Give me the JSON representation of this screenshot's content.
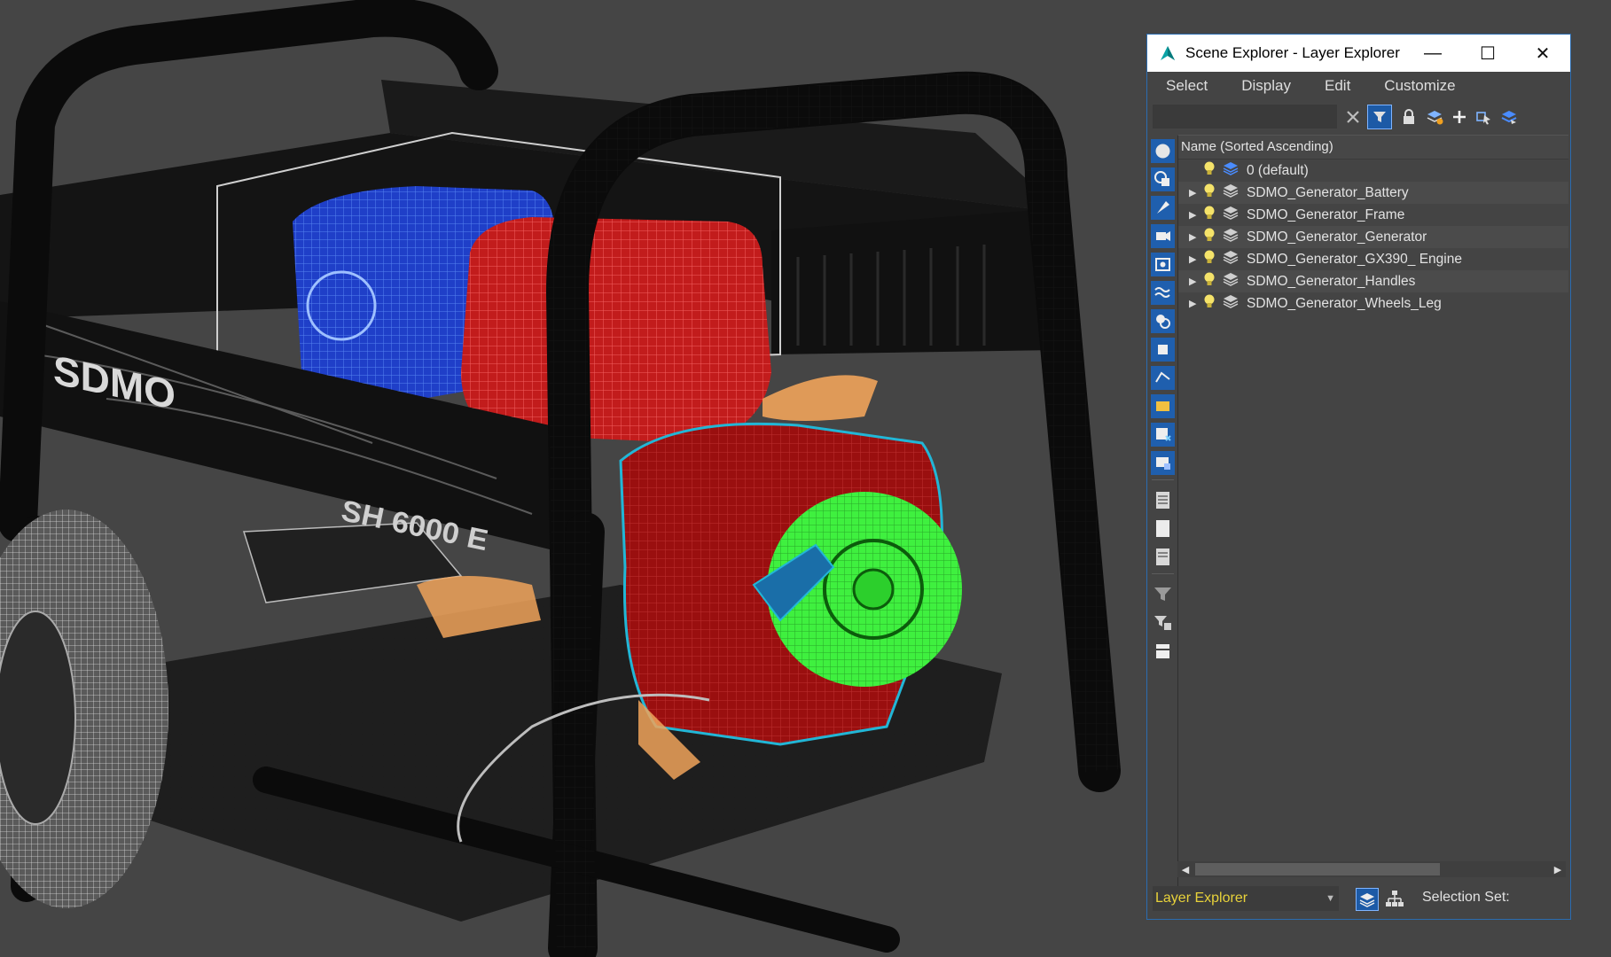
{
  "window": {
    "title": "Scene Explorer - Layer Explorer",
    "minimize": "—",
    "maximize": "☐",
    "close": "✕"
  },
  "menu": [
    "Select",
    "Display",
    "Edit",
    "Customize"
  ],
  "toolbar": {
    "search_value": "",
    "icons": [
      "clear-search-icon",
      "filter-toggle-icon",
      "lock-icon",
      "new-layer-icon",
      "add-to-layer-icon",
      "select-objects-icon",
      "layer-manager-icon"
    ]
  },
  "side_toolbar": {
    "icons": [
      "sphere-icon",
      "shapes-icon",
      "lights-icon",
      "camera-icon",
      "helpers-icon",
      "spacewarp-icon",
      "group-icon",
      "xref-icon",
      "bone-icon",
      "container-icon",
      "frozen-icon",
      "hidden-icon",
      "all-icon",
      "none-icon",
      "invert-icon",
      "filter-icon",
      "filter-settings-icon",
      "tabs-icon"
    ]
  },
  "list": {
    "column_header": "Name (Sorted Ascending)",
    "rows": [
      {
        "name": "0 (default)",
        "expandable": false
      },
      {
        "name": "SDMO_Generator_Battery",
        "expandable": true
      },
      {
        "name": "SDMO_Generator_Frame",
        "expandable": true
      },
      {
        "name": "SDMO_Generator_Generator",
        "expandable": true
      },
      {
        "name": "SDMO_Generator_GX390_ Engine",
        "expandable": true
      },
      {
        "name": "SDMO_Generator_Handles",
        "expandable": true
      },
      {
        "name": "SDMO_Generator_Wheels_Leg",
        "expandable": true
      }
    ]
  },
  "status": {
    "explorer_type": "Layer Explorer",
    "selection_set_label": "Selection Set:"
  },
  "viewport": {
    "brand_text": "SDMO",
    "model_text": "SH 6000 E"
  },
  "colors": {
    "accent": "#2b6cb0",
    "yellow_label": "#e8d23a",
    "wire_blue": "#1e4fd8",
    "wire_red": "#b01818",
    "wire_green": "#3ff03f",
    "wire_cyan": "#22b6d6",
    "wire_orange": "#f0a35a"
  }
}
